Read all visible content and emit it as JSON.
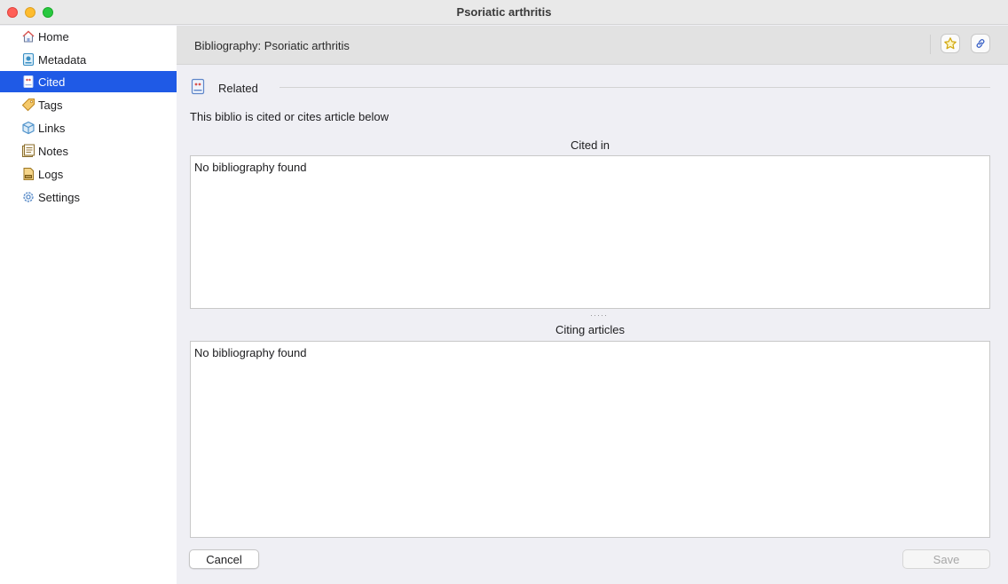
{
  "window": {
    "title": "Psoriatic arthritis"
  },
  "sidebar": {
    "items": [
      {
        "label": "Home",
        "icon": "house-icon"
      },
      {
        "label": "Metadata",
        "icon": "metadata-icon"
      },
      {
        "label": "Cited",
        "icon": "cited-book-icon",
        "active": true
      },
      {
        "label": "Tags",
        "icon": "tag-icon"
      },
      {
        "label": "Links",
        "icon": "cube-icon"
      },
      {
        "label": "Notes",
        "icon": "notes-icon"
      },
      {
        "label": "Logs",
        "icon": "log-file-icon"
      },
      {
        "label": "Settings",
        "icon": "gear-icon"
      }
    ]
  },
  "header": {
    "title": "Bibliography: Psoriatic arthritis"
  },
  "related": {
    "label": "Related",
    "description": "This biblio is cited or cites article below"
  },
  "cited_in": {
    "label": "Cited in",
    "empty_text": "No bibliography found"
  },
  "citing_articles": {
    "label": "Citing articles",
    "empty_text": "No bibliography found"
  },
  "buttons": {
    "cancel": "Cancel",
    "save": "Save"
  },
  "colors": {
    "accent": "#1f5ae6",
    "sidebar_bg": "#ffffff",
    "content_bg": "#efeff4",
    "header_bg": "#e2e2e2"
  }
}
